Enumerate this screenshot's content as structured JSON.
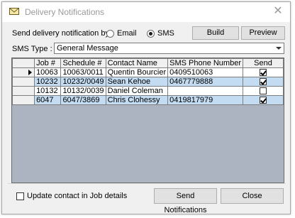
{
  "window": {
    "title": "Delivery Notifications",
    "close_glyph": "✕"
  },
  "send_by": {
    "label": "Send delivery notification by :",
    "options": [
      {
        "label": "Email",
        "selected": false
      },
      {
        "label": "SMS",
        "selected": true
      }
    ]
  },
  "buttons": {
    "build": "Build",
    "preview": "Preview",
    "send_notifications": "Send Notifications",
    "close": "Close"
  },
  "sms_type": {
    "label": "SMS Type :",
    "value": "General Message"
  },
  "grid": {
    "columns": [
      "Job #",
      "Schedule #",
      "Contact Name",
      "SMS Phone Number",
      "Send"
    ],
    "rows": [
      {
        "job": "10063",
        "schedule": "10063/0011",
        "contact": "Quentin Bourcier",
        "phone": "0409510063",
        "send": true,
        "current": true,
        "highlight": false
      },
      {
        "job": "10232",
        "schedule": "10232/0049",
        "contact": "Sean Kehoe",
        "phone": "0467779888",
        "send": true,
        "current": false,
        "highlight": true
      },
      {
        "job": "10132",
        "schedule": "10132/0039",
        "contact": "Daniel Coleman",
        "phone": "",
        "send": false,
        "current": false,
        "highlight": false
      },
      {
        "job": "6047",
        "schedule": "6047/3869",
        "contact": "Chris Clohessy",
        "phone": "0419817979",
        "send": true,
        "current": false,
        "highlight": true
      }
    ]
  },
  "update_contact": {
    "label": "Update contact in Job details",
    "checked": false
  },
  "icons": {
    "title": "envelope-icon",
    "close": "close-icon",
    "dropdown": "chevron-down-icon",
    "row_pointer": "row-pointer-icon"
  }
}
